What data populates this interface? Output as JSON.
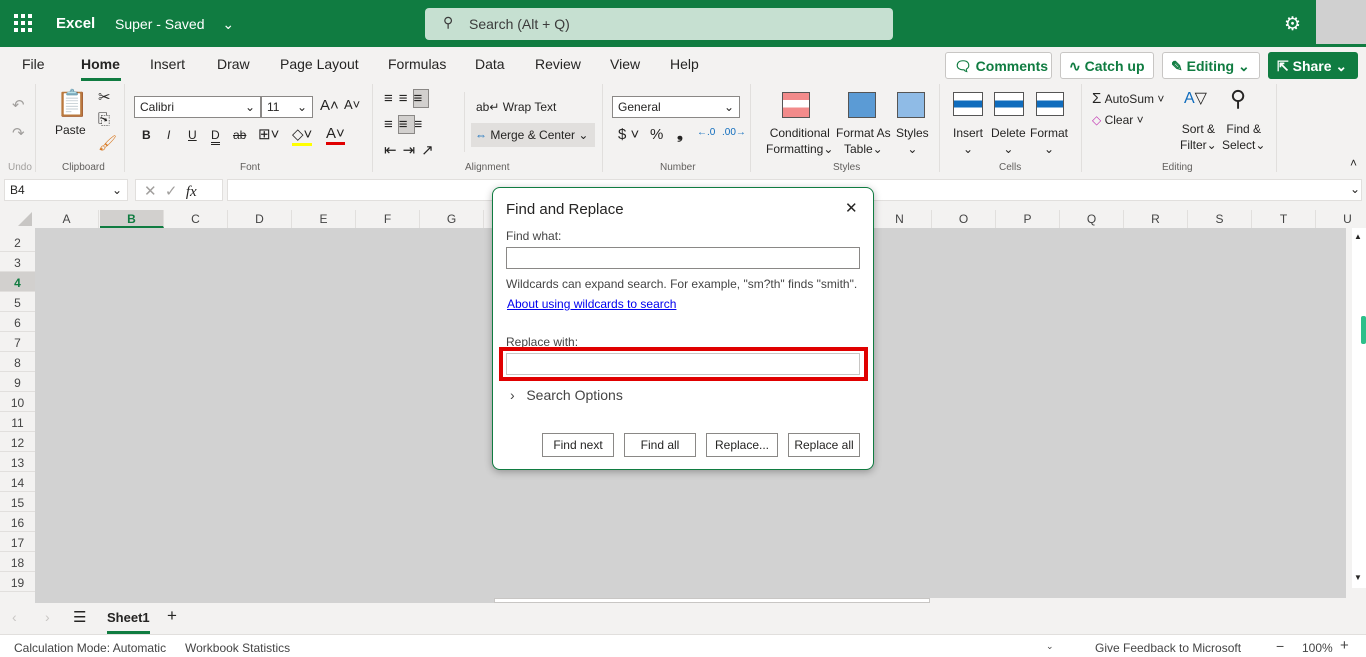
{
  "app": {
    "name": "Excel",
    "document": "Super - Saved",
    "search_placeholder": "Search (Alt + Q)",
    "colors": {
      "brand": "#107c41",
      "highlight": "#e00000"
    }
  },
  "tabs": [
    "File",
    "Home",
    "Insert",
    "Draw",
    "Page Layout",
    "Formulas",
    "Data",
    "Review",
    "View",
    "Help"
  ],
  "actions": {
    "comments": "Comments",
    "catchup": "Catch up",
    "editing": "Editing",
    "share": "Share"
  },
  "ribbon": {
    "undo": "Undo",
    "clipboard": {
      "label": "Clipboard",
      "paste": "Paste"
    },
    "font": {
      "label": "Font",
      "family": "Calibri",
      "size": "11",
      "bold": "B",
      "italic": "I",
      "underline": "U",
      "double": "D",
      "strike": "ab"
    },
    "alignment": {
      "label": "Alignment",
      "wrap": "Wrap Text",
      "merge": "Merge & Center"
    },
    "number": {
      "label": "Number",
      "format": "General",
      "currency": "$",
      "percent": "%",
      "comma": "❟"
    },
    "styles": {
      "label": "Styles",
      "conditional1": "Conditional",
      "conditional2": "Formatting",
      "table1": "Format As",
      "table2": "Table",
      "styles": "Styles"
    },
    "cells": {
      "label": "Cells",
      "insert": "Insert",
      "delete": "Delete",
      "format": "Format"
    },
    "editing": {
      "label": "Editing",
      "autosum": "AutoSum",
      "clear": "Clear",
      "sort1": "Sort &",
      "sort2": "Filter",
      "find1": "Find &",
      "find2": "Select"
    }
  },
  "formula_bar": {
    "name_box": "B4",
    "fx": "fx",
    "value": ""
  },
  "columns": [
    "A",
    "B",
    "C",
    "D",
    "E",
    "F",
    "G",
    "N",
    "O",
    "P",
    "Q",
    "R",
    "S",
    "T",
    "U"
  ],
  "rows": [
    "2",
    "3",
    "4",
    "5",
    "6",
    "7",
    "8",
    "9",
    "10",
    "11",
    "12",
    "13",
    "14",
    "15",
    "16",
    "17",
    "18",
    "19"
  ],
  "selected": {
    "column": "B",
    "row": "4"
  },
  "dialog": {
    "title": "Find and Replace",
    "find_label": "Find what:",
    "find_value": "",
    "hint": "Wildcards can expand search. For example, \"sm?th\" finds \"smith\".",
    "link": "About using wildcards to search",
    "replace_label": "Replace with:",
    "replace_value": "",
    "options": "Search Options",
    "buttons": [
      "Find next",
      "Find all",
      "Replace...",
      "Replace all"
    ]
  },
  "sheets": {
    "tabs": [
      "Sheet1"
    ],
    "active": "Sheet1"
  },
  "status": {
    "calc": "Calculation Mode: Automatic",
    "stats": "Workbook Statistics",
    "feedback": "Give Feedback to Microsoft",
    "zoom": "100%"
  }
}
